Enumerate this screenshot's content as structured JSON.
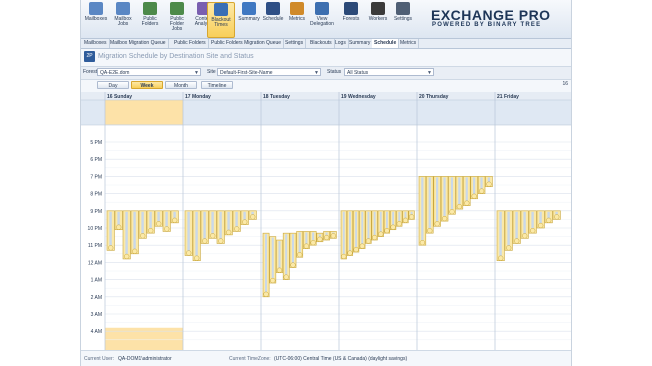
{
  "ribbon": {
    "buttons": [
      {
        "label": "Mailboxes",
        "icon": "mailboxes-icon"
      },
      {
        "label": "Mailbox Jobs",
        "icon": "mailbox-jobs-icon"
      },
      {
        "label": "Public Folders",
        "icon": "public-folders-icon"
      },
      {
        "label": "Public Folder Jobs",
        "icon": "public-folder-jobs-icon"
      },
      {
        "label": "Content Analysis",
        "icon": "content-analysis-icon"
      },
      {
        "label": "Blackout Times",
        "icon": "blackout-times-icon"
      },
      {
        "label": "Summary",
        "icon": "summary-icon"
      },
      {
        "label": "Schedule",
        "icon": "schedule-icon"
      },
      {
        "label": "Metrics",
        "icon": "metrics-icon"
      },
      {
        "label": "View Delegation",
        "icon": "view-delegation-icon"
      },
      {
        "label": "Forests",
        "icon": "forests-icon"
      },
      {
        "label": "Workers",
        "icon": "workers-icon"
      },
      {
        "label": "Settings",
        "icon": "settings-icon"
      }
    ]
  },
  "brand": {
    "title": "EXCHANGE PRO",
    "subtitle": "POWERED BY BINARY TREE"
  },
  "tabs": [
    "Mailboxes",
    "Mailbox Migration Queue",
    "Public Folders",
    "Public Folders Migration Queue",
    "Settings",
    "Blackouts",
    "Logs",
    "Summary",
    "Schedule",
    "Metrics"
  ],
  "active_tab": "Schedule",
  "header": {
    "icon_text": "2P",
    "title": "Migration Schedule by Destination Site and Status"
  },
  "filters": {
    "forest_label": "Forest",
    "forest_value": "QA-E2E.dom",
    "site_label": "Site",
    "site_value": "Default-First-Site-Name",
    "status_label": "Status",
    "status_value": "All Status"
  },
  "views": {
    "buttons": [
      "Day",
      "Week",
      "Month",
      "Timeline"
    ],
    "active": "Week",
    "end_label": "16"
  },
  "calendar": {
    "days": [
      "16 Sunday",
      "17 Monday",
      "18 Tuesday",
      "19 Wednesday",
      "20 Thursday",
      "21 Friday"
    ],
    "times": [
      "5 PM",
      "6 PM",
      "7 PM",
      "8 PM",
      "9 PM",
      "10 PM",
      "11 PM",
      "12 AM",
      "1 AM",
      "2 AM",
      "3 AM",
      "4 AM"
    ],
    "colors": {
      "event_fill": "#fbe9a8",
      "event_border": "#c9a73c",
      "event_core": "#c9d8ea",
      "highlight": "#fde2a8"
    },
    "events": [
      {
        "day": 0,
        "start": 21.0,
        "end": 23.3
      },
      {
        "day": 0,
        "start": 21.0,
        "end": 22.1
      },
      {
        "day": 0,
        "start": 21.0,
        "end": 23.8
      },
      {
        "day": 0,
        "start": 21.0,
        "end": 23.5
      },
      {
        "day": 0,
        "start": 21.0,
        "end": 22.6
      },
      {
        "day": 0,
        "start": 21.0,
        "end": 22.3
      },
      {
        "day": 0,
        "start": 21.0,
        "end": 21.9
      },
      {
        "day": 0,
        "start": 21.0,
        "end": 22.2
      },
      {
        "day": 0,
        "start": 21.0,
        "end": 21.7
      },
      {
        "day": 1,
        "start": 21.0,
        "end": 23.6
      },
      {
        "day": 1,
        "start": 21.0,
        "end": 23.9
      },
      {
        "day": 1,
        "start": 21.0,
        "end": 22.9
      },
      {
        "day": 1,
        "start": 21.0,
        "end": 22.6
      },
      {
        "day": 1,
        "start": 21.0,
        "end": 22.9
      },
      {
        "day": 1,
        "start": 21.0,
        "end": 22.4
      },
      {
        "day": 1,
        "start": 21.0,
        "end": 22.2
      },
      {
        "day": 1,
        "start": 21.0,
        "end": 21.8
      },
      {
        "day": 1,
        "start": 21.0,
        "end": 21.5
      },
      {
        "day": 2,
        "start": 22.3,
        "end": 26.0
      },
      {
        "day": 2,
        "start": 22.5,
        "end": 25.2
      },
      {
        "day": 2,
        "start": 22.7,
        "end": 24.6
      },
      {
        "day": 2,
        "start": 22.3,
        "end": 25.0
      },
      {
        "day": 2,
        "start": 22.3,
        "end": 24.3
      },
      {
        "day": 2,
        "start": 22.2,
        "end": 23.7
      },
      {
        "day": 2,
        "start": 22.2,
        "end": 23.2
      },
      {
        "day": 2,
        "start": 22.2,
        "end": 23.0
      },
      {
        "day": 2,
        "start": 22.3,
        "end": 22.8
      },
      {
        "day": 2,
        "start": 22.2,
        "end": 22.7
      },
      {
        "day": 2,
        "start": 22.2,
        "end": 22.6
      },
      {
        "day": 3,
        "start": 21.0,
        "end": 23.8
      },
      {
        "day": 3,
        "start": 21.0,
        "end": 23.6
      },
      {
        "day": 3,
        "start": 21.0,
        "end": 23.4
      },
      {
        "day": 3,
        "start": 21.0,
        "end": 23.2
      },
      {
        "day": 3,
        "start": 21.0,
        "end": 22.9
      },
      {
        "day": 3,
        "start": 21.0,
        "end": 22.7
      },
      {
        "day": 3,
        "start": 21.0,
        "end": 22.5
      },
      {
        "day": 3,
        "start": 21.0,
        "end": 22.3
      },
      {
        "day": 3,
        "start": 21.0,
        "end": 22.1
      },
      {
        "day": 3,
        "start": 21.0,
        "end": 21.9
      },
      {
        "day": 3,
        "start": 21.0,
        "end": 21.7
      },
      {
        "day": 3,
        "start": 21.0,
        "end": 21.5
      },
      {
        "day": 4,
        "start": 19.0,
        "end": 23.0
      },
      {
        "day": 4,
        "start": 19.0,
        "end": 22.3
      },
      {
        "day": 4,
        "start": 19.0,
        "end": 21.9
      },
      {
        "day": 4,
        "start": 19.0,
        "end": 21.6
      },
      {
        "day": 4,
        "start": 19.0,
        "end": 21.2
      },
      {
        "day": 4,
        "start": 19.0,
        "end": 20.9
      },
      {
        "day": 4,
        "start": 19.0,
        "end": 20.7
      },
      {
        "day": 4,
        "start": 19.0,
        "end": 20.3
      },
      {
        "day": 4,
        "start": 19.0,
        "end": 20.0
      },
      {
        "day": 4,
        "start": 19.0,
        "end": 19.6
      },
      {
        "day": 5,
        "start": 21.0,
        "end": 23.9
      },
      {
        "day": 5,
        "start": 21.0,
        "end": 23.3
      },
      {
        "day": 5,
        "start": 21.0,
        "end": 22.9
      },
      {
        "day": 5,
        "start": 21.0,
        "end": 22.6
      },
      {
        "day": 5,
        "start": 21.0,
        "end": 22.3
      },
      {
        "day": 5,
        "start": 21.0,
        "end": 22.0
      },
      {
        "day": 5,
        "start": 21.0,
        "end": 21.7
      },
      {
        "day": 5,
        "start": 21.0,
        "end": 21.5
      }
    ]
  },
  "status_bar": {
    "user_label": "Current User:",
    "user_value": "QA-DOM1\\administrator",
    "tz_label": "Current TimeZone:",
    "tz_value": "(UTC-06:00) Central Time (US & Canada) (daylight savings)"
  }
}
